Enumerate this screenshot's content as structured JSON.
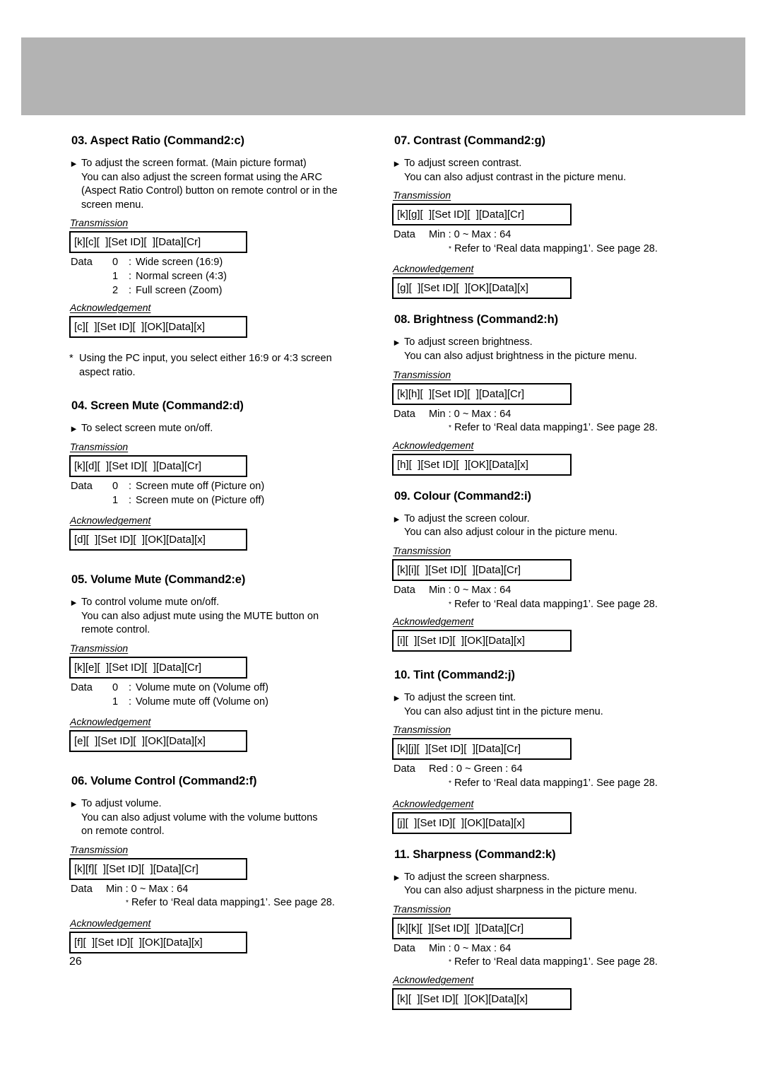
{
  "document": {
    "page_number": "26",
    "header_band_color": "#b3b3b3",
    "labels": {
      "transmission": "Transmission",
      "acknowledgement": "Acknowledgement",
      "data": "Data",
      "bullet_icon": "triangle-right-icon"
    }
  },
  "left_column": {
    "sections": [
      {
        "title": "03. Aspect Ratio (Command2:c)",
        "description": [
          "To adjust the screen format. (Main picture format)",
          "You can also adjust the screen format using the ARC",
          "(Aspect Ratio Control) button on remote control or in the",
          "screen menu."
        ],
        "transmission_label": "Transmission",
        "transmission_code": "[k][c][  ][Set ID][  ][Data][Cr]",
        "data_label": "Data",
        "data_rows": [
          {
            "key": "0",
            "colon": ":",
            "value": "Wide screen (16:9)"
          },
          {
            "key": "1",
            "colon": ":",
            "value": "Normal screen (4:3)"
          },
          {
            "key": "2",
            "colon": ":",
            "value": "Full screen (Zoom)"
          }
        ],
        "acknowledgement_label": "Acknowledgement",
        "acknowledgement_code": "[c][  ][Set ID][  ][OK][Data][x]",
        "footnote": {
          "marker": "*",
          "lines": [
            "Using the PC input, you select either 16:9 or 4:3 screen",
            "aspect ratio."
          ]
        }
      },
      {
        "title": "04. Screen Mute (Command2:d)",
        "description": [
          "To select screen mute on/off."
        ],
        "transmission_label": "Transmission",
        "transmission_code": "[k][d][  ][Set ID][  ][Data][Cr]",
        "data_label": "Data",
        "data_rows": [
          {
            "key": "0",
            "colon": ":",
            "value": "Screen mute off (Picture on)"
          },
          {
            "key": "1",
            "colon": ":",
            "value": "Screen mute on (Picture off)"
          }
        ],
        "acknowledgement_label": "Acknowledgement",
        "acknowledgement_code": "[d][  ][Set ID][  ][OK][Data][x]"
      },
      {
        "title": "05. Volume Mute (Command2:e)",
        "description": [
          "To control volume mute on/off.",
          "You can also adjust mute using the MUTE button on",
          "remote control."
        ],
        "transmission_label": "Transmission",
        "transmission_code": "[k][e][  ][Set ID][  ][Data][Cr]",
        "data_label": "Data",
        "data_rows": [
          {
            "key": "0",
            "colon": ":",
            "value": "Volume mute on (Volume off)"
          },
          {
            "key": "1",
            "colon": ":",
            "value": "Volume mute off (Volume on)"
          }
        ],
        "acknowledgement_label": "Acknowledgement",
        "acknowledgement_code": "[e][  ][Set ID][  ][OK][Data][x]"
      },
      {
        "title": "06. Volume Control (Command2:f)",
        "description": [
          "To adjust volume.",
          "You can also adjust volume with the volume buttons",
          "on remote control."
        ],
        "transmission_label": "Transmission",
        "transmission_code": "[k][f][  ][Set ID][  ][Data][Cr]",
        "data_label": "Data",
        "data_range": "Min : 0 ~ Max : 64",
        "data_note": "Refer to ‘Real data mapping1’. See page 28.",
        "acknowledgement_label": "Acknowledgement",
        "acknowledgement_code": "[f][  ][Set ID][  ][OK][Data][x]"
      }
    ]
  },
  "right_column": {
    "sections": [
      {
        "title": "07. Contrast (Command2:g)",
        "description": [
          "To adjust screen contrast.",
          "You can also adjust contrast in the picture menu."
        ],
        "transmission_label": "Transmission",
        "transmission_code": "[k][g][  ][Set ID][  ][Data][Cr]",
        "data_label": "Data",
        "data_range": "Min : 0 ~ Max : 64",
        "data_note": "Refer to ‘Real data mapping1’. See page 28.",
        "acknowledgement_label": "Acknowledgement",
        "acknowledgement_code": "[g][  ][Set ID][  ][OK][Data][x]"
      },
      {
        "title": "08. Brightness (Command2:h)",
        "description": [
          "To adjust screen brightness.",
          "You can also adjust brightness in the picture menu."
        ],
        "transmission_label": "Transmission",
        "transmission_code": "[k][h][  ][Set ID][  ][Data][Cr]",
        "data_label": "Data",
        "data_range": "Min : 0 ~ Max : 64",
        "data_note": "Refer to ‘Real data mapping1’. See page 28.",
        "acknowledgement_label": "Acknowledgement",
        "acknowledgement_code": "[h][  ][Set ID][  ][OK][Data][x]"
      },
      {
        "title": "09. Colour (Command2:i)",
        "description": [
          "To adjust the screen colour.",
          "You can also adjust colour in the picture menu."
        ],
        "transmission_label": "Transmission",
        "transmission_code": "[k][i][  ][Set ID][  ][Data][Cr]",
        "data_label": "Data",
        "data_range": "Min : 0 ~ Max : 64",
        "data_note": "Refer to ‘Real data mapping1’. See page 28.",
        "acknowledgement_label": "Acknowledgement",
        "acknowledgement_code": "[i][  ][Set ID][  ][OK][Data][x]"
      },
      {
        "title": "10. Tint (Command2:j)",
        "description": [
          "To adjust the screen tint.",
          "You can also adjust tint in the picture menu."
        ],
        "transmission_label": "Transmission",
        "transmission_code": "[k][j][  ][Set ID][  ][Data][Cr]",
        "data_label": "Data",
        "data_range": "Red : 0 ~ Green : 64",
        "data_note": "Refer to ‘Real data mapping1’. See page 28.",
        "acknowledgement_label": "Acknowledgement",
        "acknowledgement_code": "[j][  ][Set ID][  ][OK][Data][x]"
      },
      {
        "title": "11. Sharpness (Command2:k)",
        "description": [
          "To adjust the screen sharpness.",
          "You can also adjust sharpness in the picture menu."
        ],
        "transmission_label": "Transmission",
        "transmission_code": "[k][k][  ][Set ID][  ][Data][Cr]",
        "data_label": "Data",
        "data_range": "Min : 0 ~ Max : 64",
        "data_note": "Refer to ‘Real data mapping1’. See page 28.",
        "acknowledgement_label": "Acknowledgement",
        "acknowledgement_code": "[k][  ][Set ID][  ][OK][Data][x]"
      }
    ]
  }
}
